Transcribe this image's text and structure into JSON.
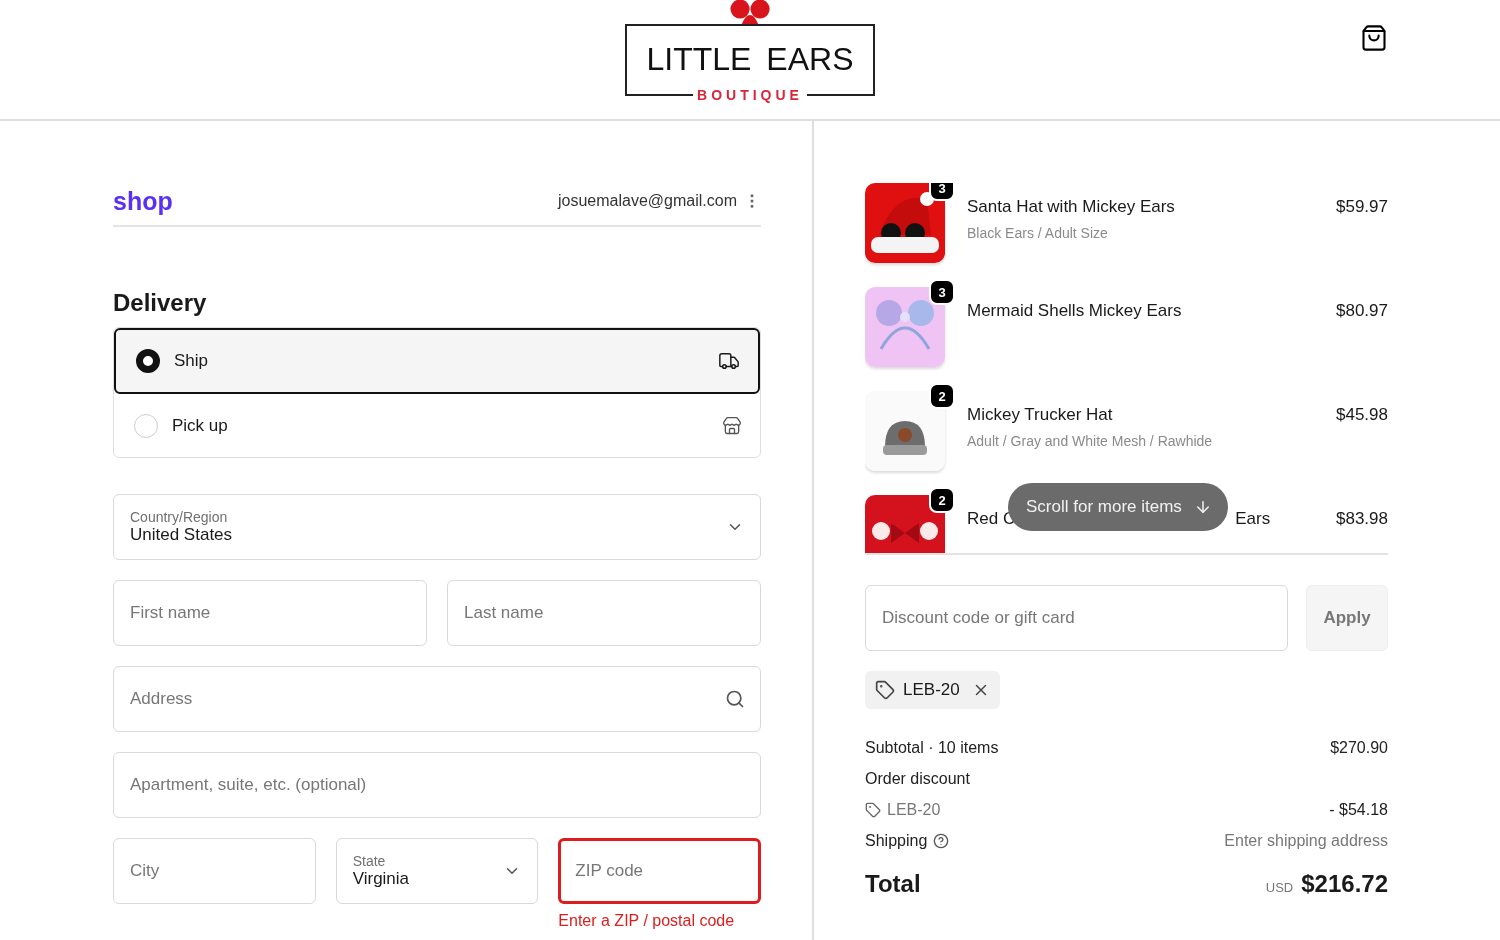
{
  "header": {
    "logo": {
      "title": "LITTLE EARS",
      "subtitle": "BOUTIQUE"
    }
  },
  "account": {
    "brand": "shop",
    "email": "josuemalave@gmail.com"
  },
  "delivery": {
    "title": "Delivery",
    "options": [
      {
        "label": "Ship",
        "kind": "ship",
        "selected": true
      },
      {
        "label": "Pick up",
        "kind": "pickup",
        "selected": false
      }
    ]
  },
  "form": {
    "country": {
      "label": "Country/Region",
      "value": "United States"
    },
    "first_name": {
      "placeholder": "First name"
    },
    "last_name": {
      "placeholder": "Last name"
    },
    "address": {
      "placeholder": "Address"
    },
    "apartment": {
      "placeholder": "Apartment, suite, etc. (optional)"
    },
    "city": {
      "placeholder": "City"
    },
    "state": {
      "label": "State",
      "value": "Virginia"
    },
    "zip": {
      "placeholder": "ZIP code",
      "invalid": true,
      "error": "Enter a ZIP / postal code"
    }
  },
  "order": {
    "items": [
      {
        "name": "Santa Hat with Mickey Ears",
        "variant": "Black Ears / Adult Size",
        "price": "$59.97",
        "quantity": "3"
      },
      {
        "name": "Mermaid Shells Mickey Ears",
        "price": "$80.97",
        "quantity": "3"
      },
      {
        "name": "Mickey Trucker Hat",
        "variant": "Adult / Gray and White Mesh / Rawhide",
        "price": "$45.98",
        "quantity": "2"
      },
      {
        "name": "Red C",
        "name_tail": "Ears",
        "price": "$83.98",
        "quantity": "2"
      }
    ],
    "scroll_hint": "Scroll for more items",
    "discount": {
      "placeholder": "Discount code or gift card",
      "button": "Apply",
      "applied_code": "LEB-20"
    },
    "summary": {
      "subtotal_label": "Subtotal · 10 items",
      "subtotal": "$270.90",
      "discount_label": "Order discount",
      "discount_code": "LEB-20",
      "discount_amount": "- $54.18",
      "shipping_label": "Shipping",
      "shipping": "Enter shipping address",
      "total_label": "Total",
      "currency": "USD",
      "total": "$216.72"
    }
  }
}
